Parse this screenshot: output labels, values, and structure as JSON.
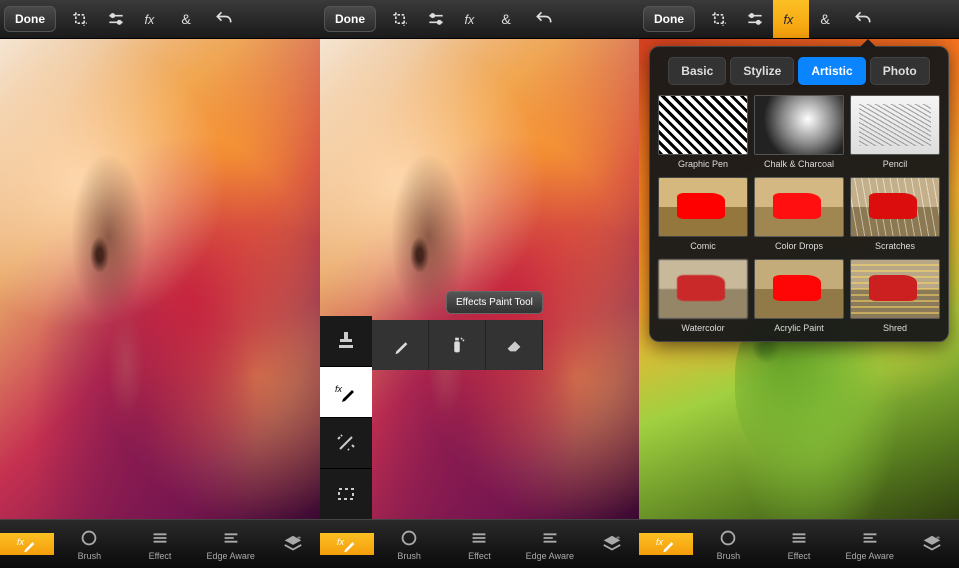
{
  "topbar": {
    "done_label": "Done",
    "icons": [
      "crop-icon",
      "adjust-icon",
      "fx-icon",
      "ampersand-icon",
      "undo-icon"
    ]
  },
  "bottombar": {
    "fx_brush": "",
    "brush": "Brush",
    "effect": "Effect",
    "edge_aware": "Edge Aware",
    "layers": ""
  },
  "side_tools": [
    "stamp-tool",
    "fx-brush-tool",
    "magic-wand-tool",
    "marquee-tool"
  ],
  "sub_tools": [
    "brush-sub",
    "spray-sub",
    "eraser-sub"
  ],
  "tooltip": "Effects Paint Tool",
  "fx_panel": {
    "tabs": [
      "Basic",
      "Stylize",
      "Artistic",
      "Photo"
    ],
    "active_tab": "Artistic",
    "effects": [
      {
        "name": "Graphic Pen"
      },
      {
        "name": "Chalk & Charcoal"
      },
      {
        "name": "Pencil"
      },
      {
        "name": "Comic"
      },
      {
        "name": "Color Drops"
      },
      {
        "name": "Scratches"
      },
      {
        "name": "Watercolor"
      },
      {
        "name": "Acrylic Paint"
      },
      {
        "name": "Shred"
      }
    ]
  }
}
